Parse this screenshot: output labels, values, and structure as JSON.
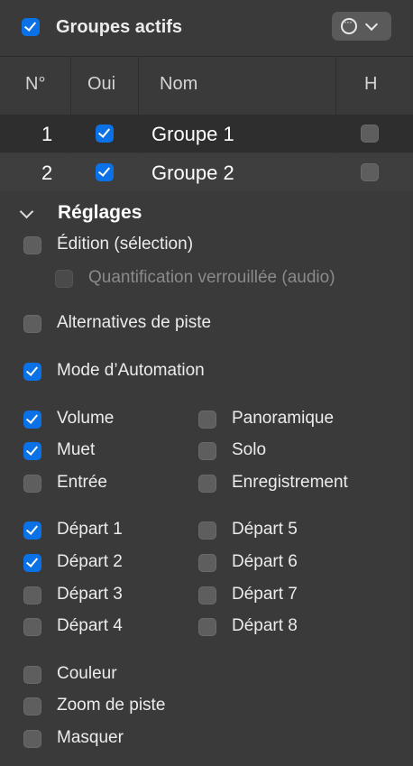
{
  "header": {
    "active_groups_label": "Groupes actifs",
    "active_groups_checked": true,
    "menu_icon": "ellipsis-circle-icon"
  },
  "table": {
    "columns": [
      "N°",
      "Oui",
      "Nom",
      "H"
    ],
    "rows": [
      {
        "number": "1",
        "yes": true,
        "name": "Groupe 1",
        "hidden": false
      },
      {
        "number": "2",
        "yes": true,
        "name": "Groupe 2",
        "hidden": false
      }
    ]
  },
  "settings": {
    "title": "Réglages",
    "edition_label": "Édition (sélection)",
    "edition_checked": false,
    "quantize_label": "Quantification verrouillée (audio)",
    "quantize_checked": false,
    "alternatives_label": "Alternatives de piste",
    "alternatives_checked": false,
    "automation_label": "Mode d’Automation",
    "automation_checked": true,
    "left_col": [
      {
        "label": "Volume",
        "checked": true
      },
      {
        "label": "Muet",
        "checked": true
      },
      {
        "label": "Entrée",
        "checked": false
      },
      {
        "label": "Départ 1",
        "checked": true
      },
      {
        "label": "Départ 2",
        "checked": true
      },
      {
        "label": "Départ 3",
        "checked": false
      },
      {
        "label": "Départ 4",
        "checked": false
      }
    ],
    "right_col": [
      {
        "label": "Panoramique",
        "checked": false
      },
      {
        "label": "Solo",
        "checked": false
      },
      {
        "label": "Enregistrement",
        "checked": false
      },
      {
        "label": "Départ 5",
        "checked": false
      },
      {
        "label": "Départ 6",
        "checked": false
      },
      {
        "label": "Départ 7",
        "checked": false
      },
      {
        "label": "Départ 8",
        "checked": false
      }
    ],
    "bottom": [
      {
        "label": "Couleur",
        "checked": false
      },
      {
        "label": "Zoom de piste",
        "checked": false
      },
      {
        "label": "Masquer",
        "checked": false
      }
    ]
  },
  "colors": {
    "accent": "#0a72e6",
    "background": "#3a3a3a"
  }
}
